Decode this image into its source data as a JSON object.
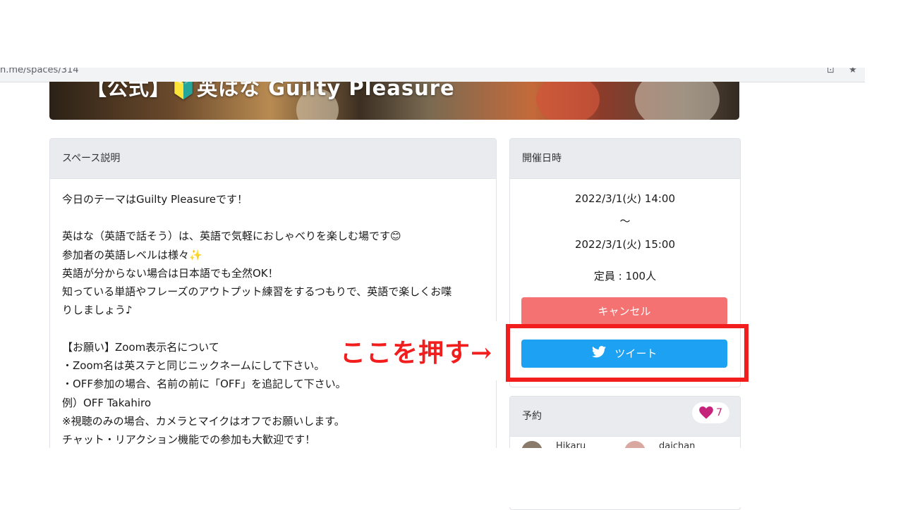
{
  "browser": {
    "url": "n.me/spaces/314"
  },
  "hero": {
    "title": "【公式】🔰英はな Guilty Pleasure"
  },
  "description": {
    "header": "スペース説明",
    "lines": [
      "今日のテーマはGuilty Pleasureです！",
      "",
      "英はな（英語で話そう）は、英語で気軽におしゃべりを楽しむ場です😊",
      "参加者の英語レベルは様々✨",
      "英語が分からない場合は日本語でも全然OK！",
      "知っている単語やフレーズのアウトプット練習をするつもりで、英語で楽しくお喋",
      "りしましょう♪",
      "",
      "【お願い】Zoom表示名について",
      "・Zoom名は英ステと同じニックネームにして下さい。",
      "・OFF参加の場合、名前の前に「OFF」を追記して下さい。",
      " 例）OFF Takahiro",
      "※視聴のみの場合、カメラとマイクはオフでお願いします。",
      "チャット・リアクション機能での参加も大歓迎です！"
    ]
  },
  "schedule": {
    "header": "開催日時",
    "start": "2022/3/1(火) 14:00",
    "separator": "〜",
    "end": "2022/3/1(火) 15:00",
    "capacity": "定員 : 100人",
    "cancel_label": "キャンセル",
    "tweet_label": "ツイート"
  },
  "reservation": {
    "header": "予約",
    "like_count": "7",
    "members": [
      "Hikaru",
      "daichan"
    ]
  },
  "annotation": {
    "text": "ここを押す→",
    "color": "#f21d1d"
  },
  "colors": {
    "cancel": "#f47272",
    "tweet": "#1da1f2",
    "heart": "#c6247b"
  }
}
